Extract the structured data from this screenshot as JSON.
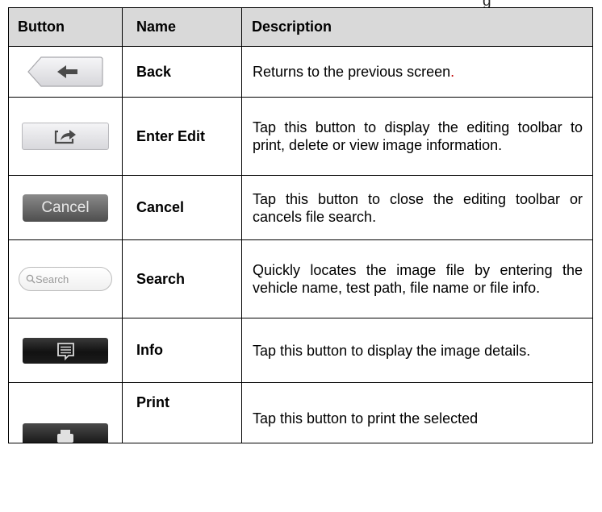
{
  "top_text": "g",
  "table": {
    "headers": [
      "Button",
      "Name",
      "Description"
    ],
    "rows": [
      {
        "icon": "back-arrow-button-icon",
        "name": "Back",
        "description": "Returns to the previous screen",
        "description_end": "."
      },
      {
        "icon": "enter-edit-share-icon",
        "name": "Enter Edit",
        "description": "Tap this button to display the editing toolbar to print, delete or view image information."
      },
      {
        "icon": "cancel-button-icon",
        "icon_text": "Cancel",
        "name": "Cancel",
        "description": "Tap this button to close the editing toolbar or cancels file search."
      },
      {
        "icon": "search-field-icon",
        "icon_text": "Search",
        "name": "Search",
        "description": "Quickly locates the image file by entering the vehicle name, test path, file name or file info."
      },
      {
        "icon": "info-message-icon",
        "name": "Info",
        "description": "Tap this button to display the image details."
      },
      {
        "icon": "printer-icon",
        "name": "Print",
        "description": "Tap this button to print the selected"
      }
    ]
  },
  "colors": {
    "header_bg": "#d9d9d9",
    "accent_red": "#c00000"
  }
}
